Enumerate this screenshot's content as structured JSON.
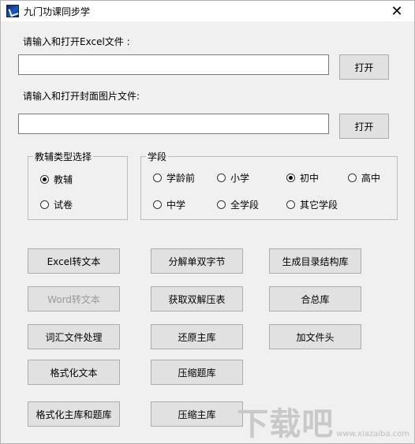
{
  "window": {
    "title": "九门功课同步学",
    "close_glyph": "✕"
  },
  "excel": {
    "label": "请输入和打开Excel文件 :",
    "value": "",
    "open_label": "打开"
  },
  "cover": {
    "label": "请输入和打开封面图片文件:",
    "value": "",
    "open_label": "打开"
  },
  "type_group": {
    "legend": "教辅类型选择",
    "options": [
      {
        "label": "教辅",
        "checked": true
      },
      {
        "label": "试卷",
        "checked": false
      }
    ]
  },
  "stage_group": {
    "legend": "学段",
    "options": [
      {
        "label": "学龄前",
        "checked": false
      },
      {
        "label": "小学",
        "checked": false
      },
      {
        "label": "初中",
        "checked": true
      },
      {
        "label": "高中",
        "checked": false
      },
      {
        "label": "中学",
        "checked": false
      },
      {
        "label": "全学段",
        "checked": false
      },
      {
        "label": "其它学段",
        "checked": false
      }
    ]
  },
  "actions": {
    "excel_to_text": "Excel转文本",
    "word_to_text": "Word转文本",
    "vocab_process": "词汇文件处理",
    "format_text": "格式化文本",
    "format_main_and_questions": "格式化主库和题库",
    "split_double_bytes": "分解单双字节",
    "get_double_compress": "获取双解压表",
    "restore_main": "还原主库",
    "compress_questions": "压缩题库",
    "compress_main": "压缩主库",
    "gen_catalog": "生成目录结构库",
    "merge_library": "合总库",
    "add_header": "加文件头"
  },
  "watermark": {
    "logo": "下载吧",
    "url": "www.xiazaiba.com"
  }
}
